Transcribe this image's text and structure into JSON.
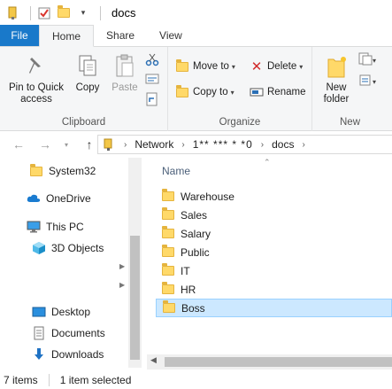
{
  "window": {
    "title": "docs"
  },
  "ribbon_tabs": [
    {
      "label": "File"
    },
    {
      "label": "Home"
    },
    {
      "label": "Share"
    },
    {
      "label": "View"
    }
  ],
  "clipboard": {
    "pin_label": "Pin to Quick access",
    "copy_label": "Copy",
    "paste_label": "Paste",
    "group_label": "Clipboard"
  },
  "organize": {
    "move_to": "Move to",
    "copy_to": "Copy to",
    "delete": "Delete",
    "rename": "Rename",
    "group_label": "Organize"
  },
  "new_group": {
    "new_folder": "New folder",
    "group_label": "New"
  },
  "address": {
    "crumbs": [
      "Network",
      "1** *** * *0",
      "docs"
    ]
  },
  "nav_pane": {
    "items": [
      "System32",
      "OneDrive",
      "This PC",
      "3D Objects",
      "Desktop",
      "Documents",
      "Downloads"
    ]
  },
  "file_list": {
    "column_name": "Name",
    "files": [
      "Warehouse",
      "Sales",
      "Salary",
      "Public",
      "IT",
      "HR",
      "Boss"
    ],
    "selected": "Boss"
  },
  "status": {
    "item_count": "7 items",
    "selection": "1 item selected"
  },
  "colors": {
    "file_tab": "#1979ca",
    "selection": "#cce8ff",
    "folder": "#ffd969"
  }
}
